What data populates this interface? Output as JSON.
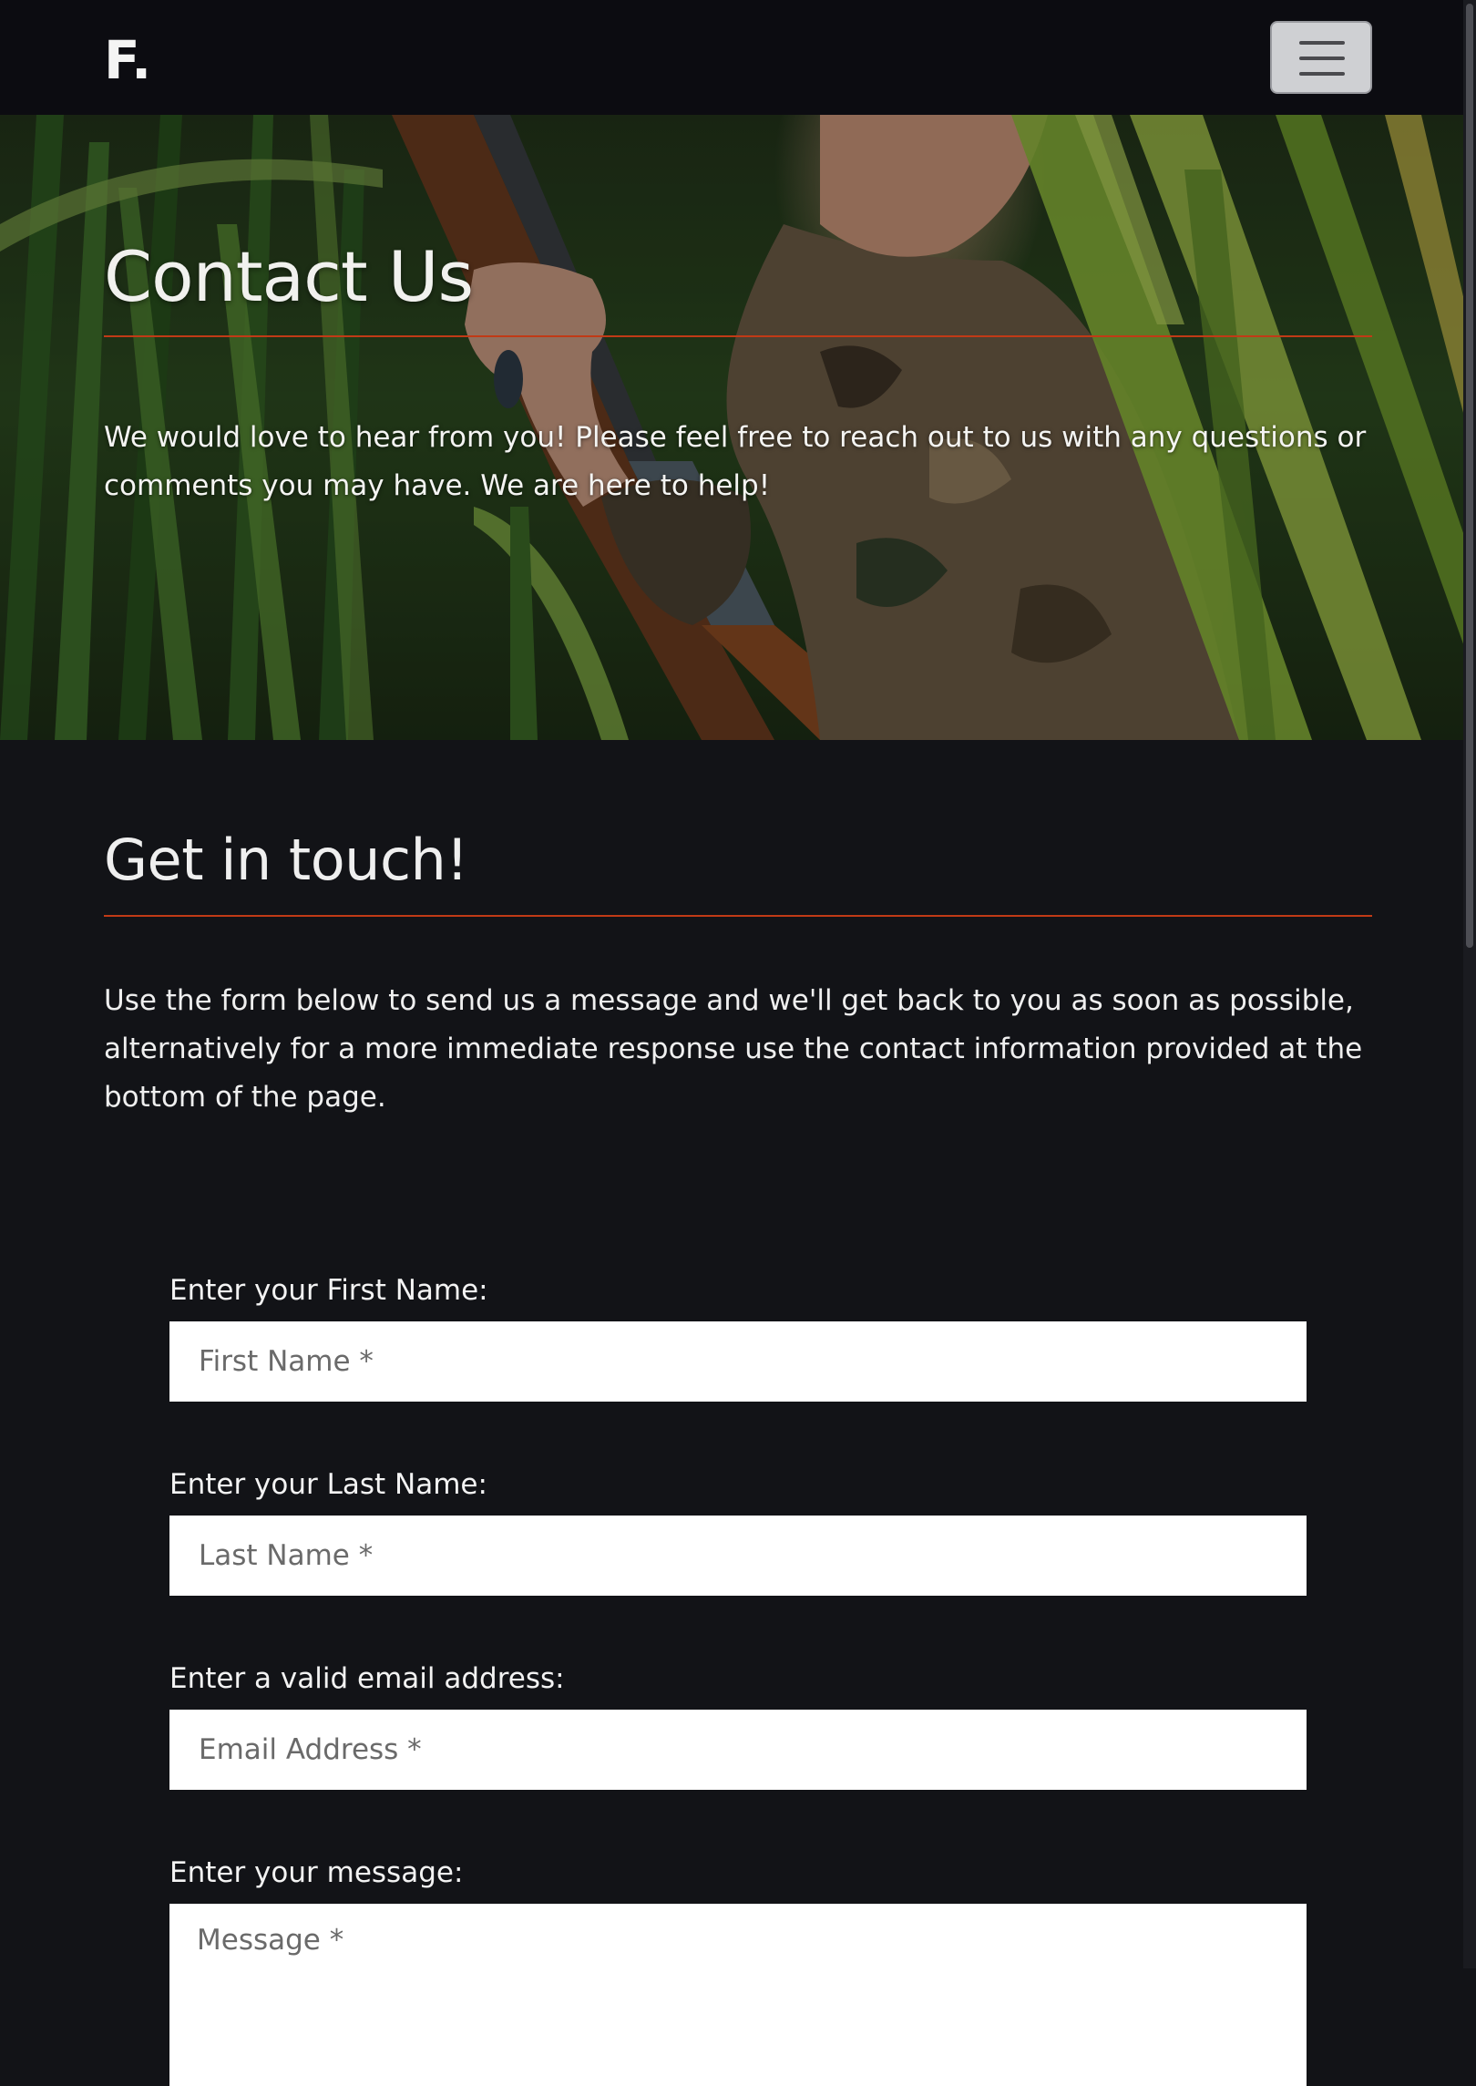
{
  "navbar": {
    "brand": "F.",
    "menu_icon": "hamburger-menu-icon"
  },
  "hero": {
    "title": "Contact Us",
    "text": "We would love to hear from you! Please feel free to reach out to us with any questions or comments you may have. We are here to help!"
  },
  "section": {
    "title": "Get in touch!",
    "text": "Use the form below to send us a message and we'll get back to you as soon as possible, alternatively for a more immediate response use the contact information provided at the bottom of the page."
  },
  "form": {
    "first_name": {
      "label": "Enter your First Name:",
      "placeholder": "First Name *",
      "value": ""
    },
    "last_name": {
      "label": "Enter your Last Name:",
      "placeholder": "Last Name *",
      "value": ""
    },
    "email": {
      "label": "Enter a valid email address:",
      "placeholder": "Email Address *",
      "value": ""
    },
    "message": {
      "label": "Enter your message:",
      "placeholder": "Message *",
      "value": ""
    }
  },
  "colors": {
    "accent": "#c13a16",
    "page_background": "#121317",
    "navbar_background": "#0c0c11"
  }
}
